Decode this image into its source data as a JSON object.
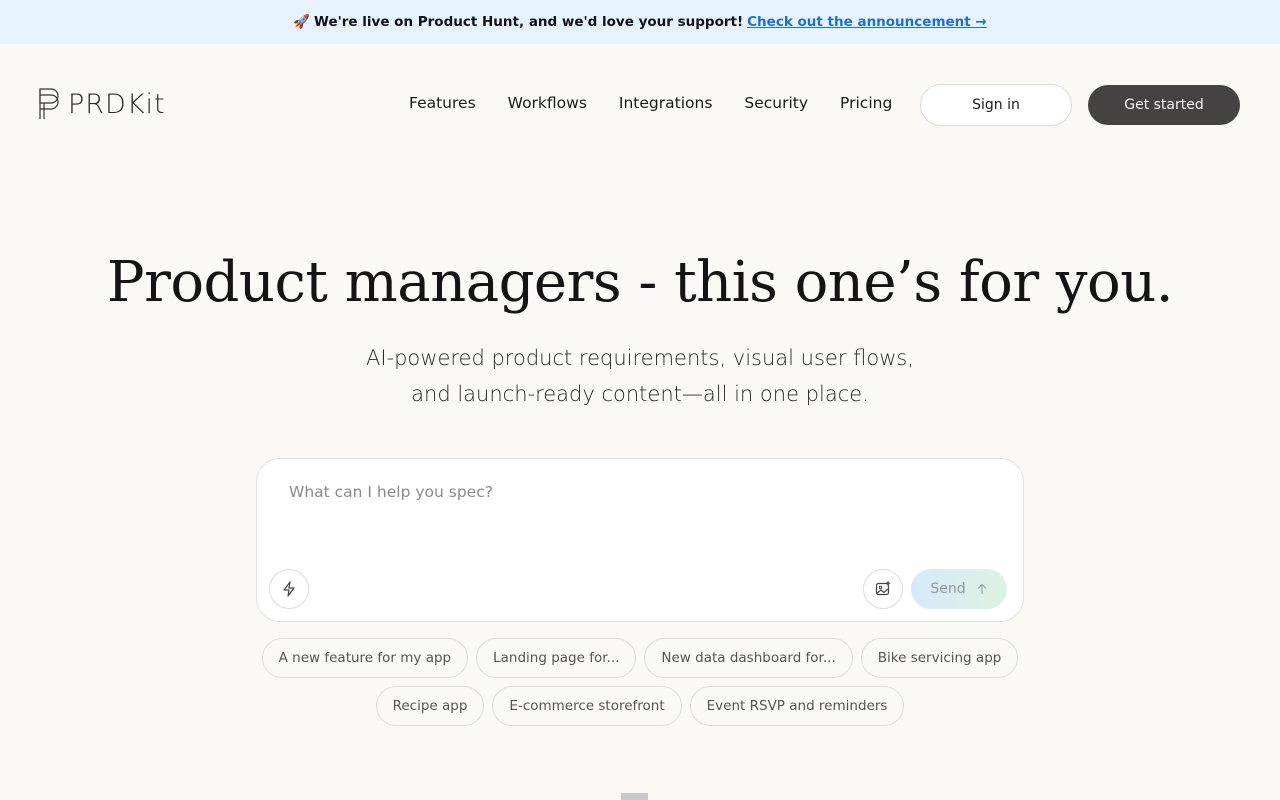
{
  "banner": {
    "emoji": "🚀",
    "text": "We're live on Product Hunt, and we'd love your support!",
    "link": "Check out the announcement →"
  },
  "logo": {
    "text": "PRDKit"
  },
  "nav": {
    "items": [
      "Features",
      "Workflows",
      "Integrations",
      "Security",
      "Pricing"
    ]
  },
  "auth": {
    "signin": "Sign in",
    "start": "Get started"
  },
  "hero": {
    "title": "Product managers - this one’s for you.",
    "subtitle_line1": "AI-powered product requirements, visual user flows,",
    "subtitle_line2": "and launch-ready content—all in one place."
  },
  "prompt": {
    "placeholder": "What can I help you spec?",
    "send": "Send"
  },
  "suggestions": {
    "row1": [
      "A new feature for my app",
      "Landing page for...",
      "New data dashboard for...",
      "Bike servicing app"
    ],
    "row2": [
      "Recipe app",
      "E-commerce storefront",
      "Event RSVP and reminders"
    ]
  },
  "icons": {
    "bolt": "lightning-icon",
    "image": "image-upload-icon",
    "send": "arrow-up-icon"
  },
  "colors": {
    "banner_bg": "#e6f2fd",
    "link": "#1f6fd0",
    "primary_button": "#444341",
    "page_bg": "#faf9f6"
  }
}
